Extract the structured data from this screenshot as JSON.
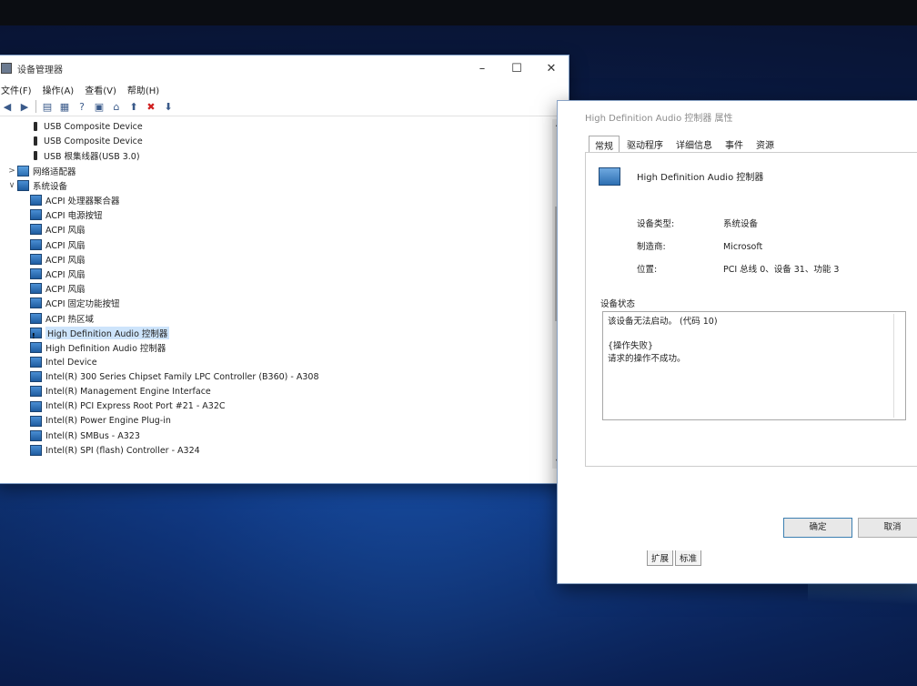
{
  "device_manager": {
    "title": "设备管理器",
    "controls": [
      "–",
      "☐",
      "✕"
    ],
    "menu": [
      "文件(F)",
      "操作(A)",
      "查看(V)",
      "帮助(H)"
    ],
    "tree": [
      {
        "indent": 2,
        "icon": "usb",
        "label": "USB Composite Device"
      },
      {
        "indent": 2,
        "icon": "usb",
        "label": "USB Composite Device"
      },
      {
        "indent": 2,
        "icon": "usb",
        "label": "USB 根集线器(USB 3.0)"
      },
      {
        "indent": 1,
        "icon": "net",
        "expander": ">",
        "label": "网络适配器"
      },
      {
        "indent": 1,
        "icon": "sys",
        "expander": "∨",
        "label": "系统设备"
      },
      {
        "indent": 2,
        "icon": "sys",
        "label": "ACPI 处理器聚合器"
      },
      {
        "indent": 2,
        "icon": "sys",
        "label": "ACPI 电源按钮"
      },
      {
        "indent": 2,
        "icon": "sys",
        "label": "ACPI 风扇"
      },
      {
        "indent": 2,
        "icon": "sys",
        "label": "ACPI 风扇"
      },
      {
        "indent": 2,
        "icon": "sys",
        "label": "ACPI 风扇"
      },
      {
        "indent": 2,
        "icon": "sys",
        "label": "ACPI 风扇"
      },
      {
        "indent": 2,
        "icon": "sys",
        "label": "ACPI 风扇"
      },
      {
        "indent": 2,
        "icon": "sys",
        "label": "ACPI 固定功能按钮"
      },
      {
        "indent": 2,
        "icon": "sys",
        "label": "ACPI 热区域"
      },
      {
        "indent": 2,
        "icon": "warn",
        "label": "High Definition Audio 控制器",
        "selected": true
      },
      {
        "indent": 2,
        "icon": "sys",
        "label": "High Definition Audio 控制器"
      },
      {
        "indent": 2,
        "icon": "sys",
        "label": "Intel Device"
      },
      {
        "indent": 2,
        "icon": "sys",
        "label": "Intel(R) 300 Series Chipset Family LPC Controller (B360) - A308"
      },
      {
        "indent": 2,
        "icon": "sys",
        "label": "Intel(R) Management Engine Interface"
      },
      {
        "indent": 2,
        "icon": "sys",
        "label": "Intel(R) PCI Express Root Port #21 - A32C"
      },
      {
        "indent": 2,
        "icon": "sys",
        "label": "Intel(R) Power Engine Plug-in"
      },
      {
        "indent": 2,
        "icon": "sys",
        "label": "Intel(R) SMBus - A323"
      },
      {
        "indent": 2,
        "icon": "sys",
        "label": "Intel(R) SPI (flash) Controller - A324"
      }
    ]
  },
  "properties": {
    "title": "High Definition Audio 控制器 属性",
    "tabs": [
      "常规",
      "驱动程序",
      "详细信息",
      "事件",
      "资源"
    ],
    "device_name": "High Definition Audio 控制器",
    "fields": [
      {
        "key": "设备类型:",
        "value": "系统设备"
      },
      {
        "key": "制造商:",
        "value": "Microsoft"
      },
      {
        "key": "位置:",
        "value": "PCI 总线 0、设备 31、功能 3"
      }
    ],
    "status_label": "设备状态",
    "status_lines": [
      "该设备无法启动。 (代码 10)",
      "",
      "{操作失败}",
      "请求的操作不成功。"
    ],
    "ok_label": "确定",
    "cancel_label": "取消",
    "bottom_tabs": [
      "扩展",
      "标准"
    ]
  }
}
